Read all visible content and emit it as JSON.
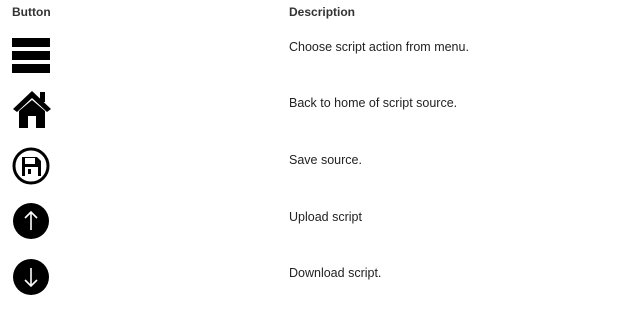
{
  "table": {
    "headers": {
      "button": "Button",
      "description": "Description"
    },
    "rows": [
      {
        "icon": "menu-icon",
        "description": "Choose script action from menu."
      },
      {
        "icon": "home-icon",
        "description": "Back to home of script source."
      },
      {
        "icon": "save-icon",
        "description": "Save source."
      },
      {
        "icon": "upload-icon",
        "description": "Upload script"
      },
      {
        "icon": "download-icon",
        "description": "Download script."
      }
    ]
  }
}
